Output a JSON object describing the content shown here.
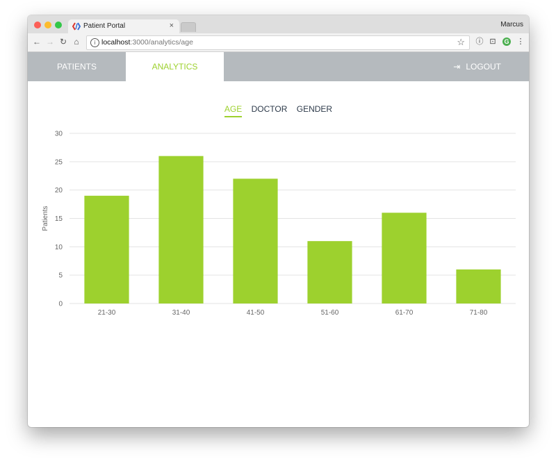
{
  "browser": {
    "tab_title": "Patient Portal",
    "tab_close": "×",
    "user": "Marcus",
    "url_host": "localhost",
    "url_path": ":3000/analytics/age"
  },
  "nav": {
    "patients": "PATIENTS",
    "analytics": "ANALYTICS",
    "logout": "LOGOUT"
  },
  "subtabs": [
    "AGE",
    "DOCTOR",
    "GENDER"
  ],
  "colors": {
    "accent": "#9dd12e",
    "nav_bg": "#b5babe",
    "text": "#2d3a4a"
  },
  "chart_data": {
    "type": "bar",
    "categories": [
      "21-30",
      "31-40",
      "41-50",
      "51-60",
      "61-70",
      "71-80"
    ],
    "values": [
      19,
      26,
      22,
      11,
      16,
      6
    ],
    "ylabel": "Patients",
    "ylim": [
      0,
      30
    ],
    "yticks": [
      0,
      5,
      10,
      15,
      20,
      25,
      30
    ],
    "grid": true
  }
}
